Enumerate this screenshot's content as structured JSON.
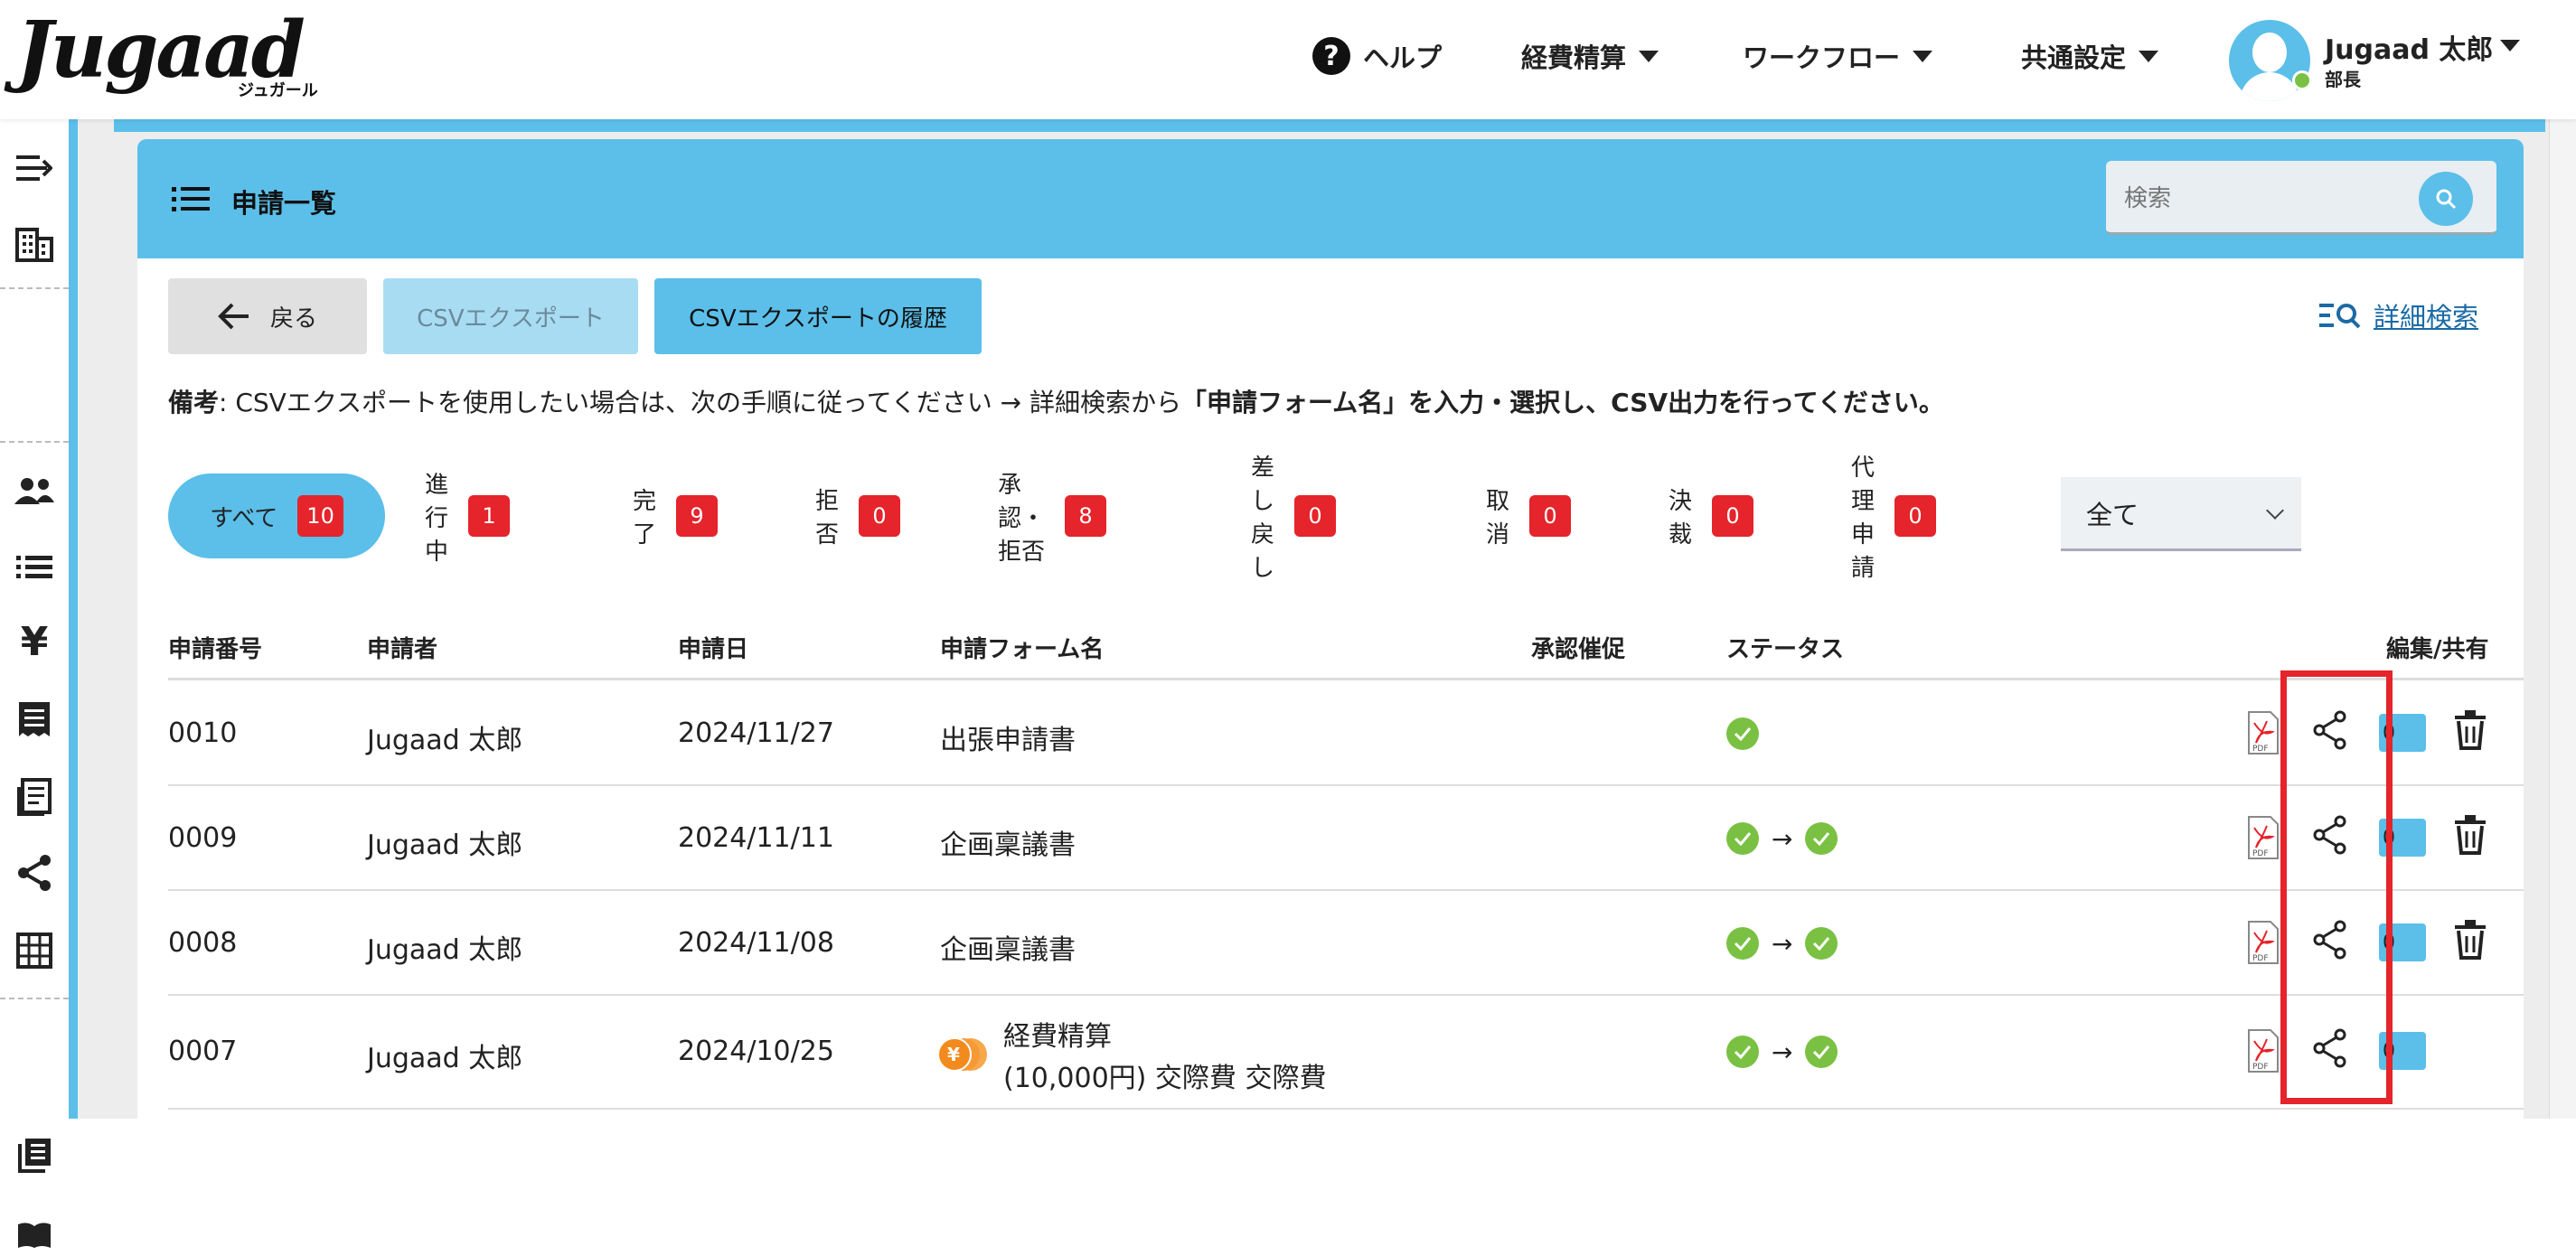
{
  "header": {
    "logo_text": "Jugaad",
    "logo_sub": "ジュガール",
    "nav": {
      "help": "ヘルプ",
      "expense": "経費精算",
      "workflow": "ワークフロー",
      "settings": "共通設定"
    },
    "user": {
      "name": "Jugaad 太郎",
      "role": "部長"
    }
  },
  "card": {
    "title": "申請一覧",
    "search_placeholder": "検索"
  },
  "toolbar": {
    "back_label": "戻る",
    "csv_export_label": "CSVエクスポート",
    "csv_history_label": "CSVエクスポートの履歴",
    "advanced_search_label": "詳細検索"
  },
  "note": {
    "label": "備考",
    "text_plain": ": CSVエクスポートを使用したい場合は、次の手順に従ってください → 詳細検索から",
    "text_bold": "「申請フォーム名」を入力・選択し、CSV出力を行ってください。"
  },
  "filters": [
    {
      "label": "すべて",
      "count": "10"
    },
    {
      "label": "進行中",
      "count": "1"
    },
    {
      "label": "完了",
      "count": "9"
    },
    {
      "label": "拒否",
      "count": "0"
    },
    {
      "label": "承認・拒否",
      "count": "8"
    },
    {
      "label": "差し戻し",
      "count": "0"
    },
    {
      "label": "取消",
      "count": "0"
    },
    {
      "label": "決裁",
      "count": "0"
    },
    {
      "label": "代理申請",
      "count": "0"
    }
  ],
  "select_value": "全て",
  "table": {
    "headers": {
      "number": "申請番号",
      "applicant": "申請者",
      "date": "申請日",
      "form": "申請フォーム名",
      "reminder": "承認催促",
      "status": "ステータス",
      "edit_share": "編集/共有"
    },
    "rows": [
      {
        "number": "0010",
        "applicant": "Jugaad 太郎",
        "date": "2024/11/27",
        "form": "出張申請書",
        "badge": "0"
      },
      {
        "number": "0009",
        "applicant": "Jugaad 太郎",
        "date": "2024/11/11",
        "form": "企画稟議書",
        "badge": "0"
      },
      {
        "number": "0008",
        "applicant": "Jugaad 太郎",
        "date": "2024/11/08",
        "form": "企画稟議書",
        "badge": "0"
      },
      {
        "number": "0007",
        "applicant": "Jugaad 太郎",
        "date": "2024/10/25",
        "form": "経費精算",
        "form_line2": "(10,000円) 交際費 交際費",
        "badge": "0"
      }
    ],
    "arrow": "→"
  },
  "colors": {
    "accent": "#5bbfe9",
    "badge_red": "#e5242b",
    "check_green": "#7ac143",
    "highlight": "#e5242b"
  }
}
